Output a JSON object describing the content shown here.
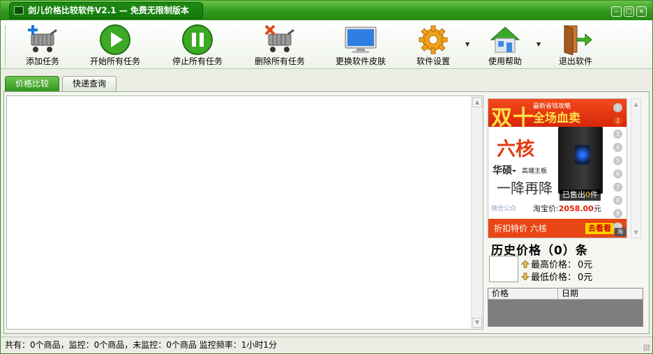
{
  "window": {
    "title": "剑儿价格比较软件V2.1 — 免费无限制版本",
    "controls": {
      "minimize": "–",
      "maximize": "□",
      "close": "×"
    }
  },
  "toolbar": {
    "add_task": "添加任务",
    "start_all": "开始所有任务",
    "stop_all": "停止所有任务",
    "delete_all": "删除所有任务",
    "change_skin": "更换软件皮肤",
    "settings": "软件设置",
    "help": "使用帮助",
    "exit": "退出软件",
    "icons": {
      "add_task": "cart-add-icon",
      "start_all": "play-icon",
      "stop_all": "pause-icon",
      "delete_all": "cart-delete-icon",
      "change_skin": "monitor-icon",
      "settings": "gear-icon",
      "help": "house-icon",
      "exit": "exit-door-icon"
    }
  },
  "tabs": [
    {
      "label": "价格比较",
      "active": true
    },
    {
      "label": "快递查询",
      "active": false
    }
  ],
  "ad": {
    "headline": "双十",
    "tag_small": "最新省钱攻略",
    "tag_big": "全场血卖",
    "core": "六核",
    "brand": "华硕-",
    "brand_sub": "高端主板",
    "drop": "一降再降",
    "sold_prefix": "已售出",
    "sold_count": "0",
    "sold_suffix": "件",
    "logo_text": "微信公众",
    "price_label": "淘宝价:",
    "price_value": "2058.00",
    "price_unit": "元",
    "bottom_text": "折扣特价 六核",
    "go_label": "去看看",
    "taobao_mark": "淘",
    "carousel": [
      "1",
      "2",
      "3",
      "4",
      "5",
      "6",
      "7",
      "8",
      "9",
      "10"
    ],
    "carousel_active": 2
  },
  "history": {
    "title": "历史价格（0）条",
    "max_label": "最高价格：",
    "max_value": "0元",
    "min_label": "最低价格：",
    "min_value": "0元",
    "col_price": "价格",
    "col_date": "日期"
  },
  "status": {
    "text": "共有：0个商品，监控：0个商品，未监控：0个商品 监控频率：1小时1分"
  },
  "colors": {
    "brand_green": "#2f9a1d",
    "ad_red": "#e84614",
    "price_red": "#e02000"
  }
}
